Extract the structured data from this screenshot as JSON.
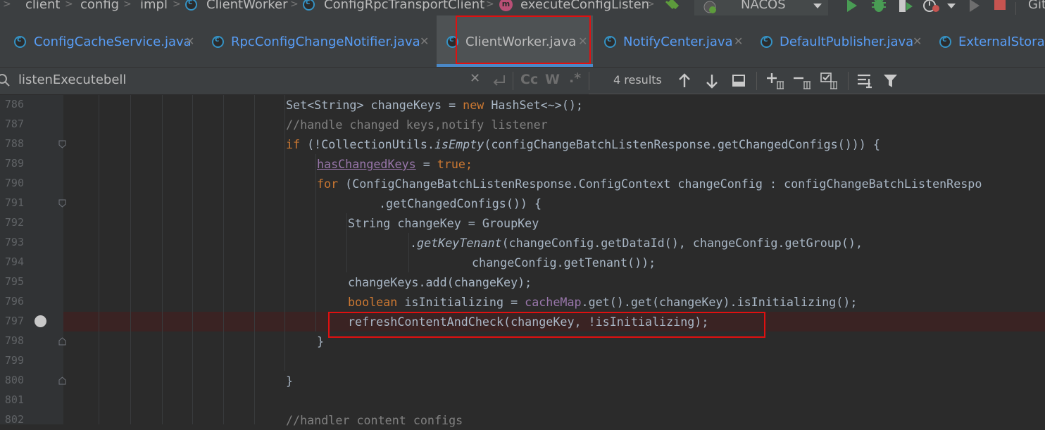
{
  "breadcrumbs": {
    "items": [
      "client",
      "config",
      "impl",
      "ClientWorker",
      "ConfigRpcTransportClient",
      "executeConfigListen"
    ],
    "method_icon_letter": "m"
  },
  "toolbar": {
    "run_config": "NACOS",
    "vcs_label": "Git"
  },
  "tabs": [
    {
      "label": "ConfigCacheService.java",
      "active": false
    },
    {
      "label": "RpcConfigChangeNotifier.java",
      "active": false
    },
    {
      "label": "ClientWorker.java",
      "active": true
    },
    {
      "label": "NotifyCenter.java",
      "active": false
    },
    {
      "label": "DefaultPublisher.java",
      "active": false
    },
    {
      "label": "ExternalStorag",
      "active": false
    }
  ],
  "search": {
    "query": "listenExecutebell",
    "case_label": "Cc",
    "word_label": "W",
    "regex_label": ".*",
    "results": "4 results"
  },
  "editor": {
    "line_numbers": [
      "786",
      "787",
      "788",
      "789",
      "790",
      "791",
      "792",
      "793",
      "794",
      "795",
      "796",
      "797",
      "798",
      "799",
      "800",
      "801",
      "802"
    ],
    "breakpoint_line": "797",
    "highlighted_line": "797",
    "colors": {
      "keyword": "#cc7832",
      "comment": "#808080",
      "field": "#9876aa",
      "text": "#a9b7c6",
      "highlight_box": "#e01010"
    },
    "code": {
      "l786_a": "Set<String> changeKeys = ",
      "l786_kw": "new",
      "l786_b": " HashSet<~>();",
      "l787": "//handle changed keys,notify listener",
      "l788_kw": "if",
      "l788_a": " (!CollectionUtils.",
      "l788_it": "isEmpty",
      "l788_b": "(configChangeBatchListenResponse.getChangedConfigs())) {",
      "l789_fld": "hasChangedKeys",
      "l789_a": " = ",
      "l789_kw": "true",
      "l789_b": ";",
      "l790_kw": "for",
      "l790_a": " (ConfigChangeBatchListenResponse.ConfigContext changeConfig : configChangeBatchListenRespo",
      "l791": ".getChangedConfigs()) {",
      "l792": "String changeKey = GroupKey",
      "l793_a": ".",
      "l793_it": "getKeyTenant",
      "l793_b": "(changeConfig.getDataId(), changeConfig.getGroup(),",
      "l794": "changeConfig.getTenant());",
      "l795": "changeKeys.add(changeKey);",
      "l796_kw": "boolean",
      "l796_a": " isInitializing = ",
      "l796_fld": "cacheMap",
      "l796_b": ".get().get(changeKey).isInitializing();",
      "l797": "refreshContentAndCheck(changeKey, !isInitializing);",
      "l798": "}",
      "l800": "}",
      "l802": "//handler content configs"
    }
  }
}
